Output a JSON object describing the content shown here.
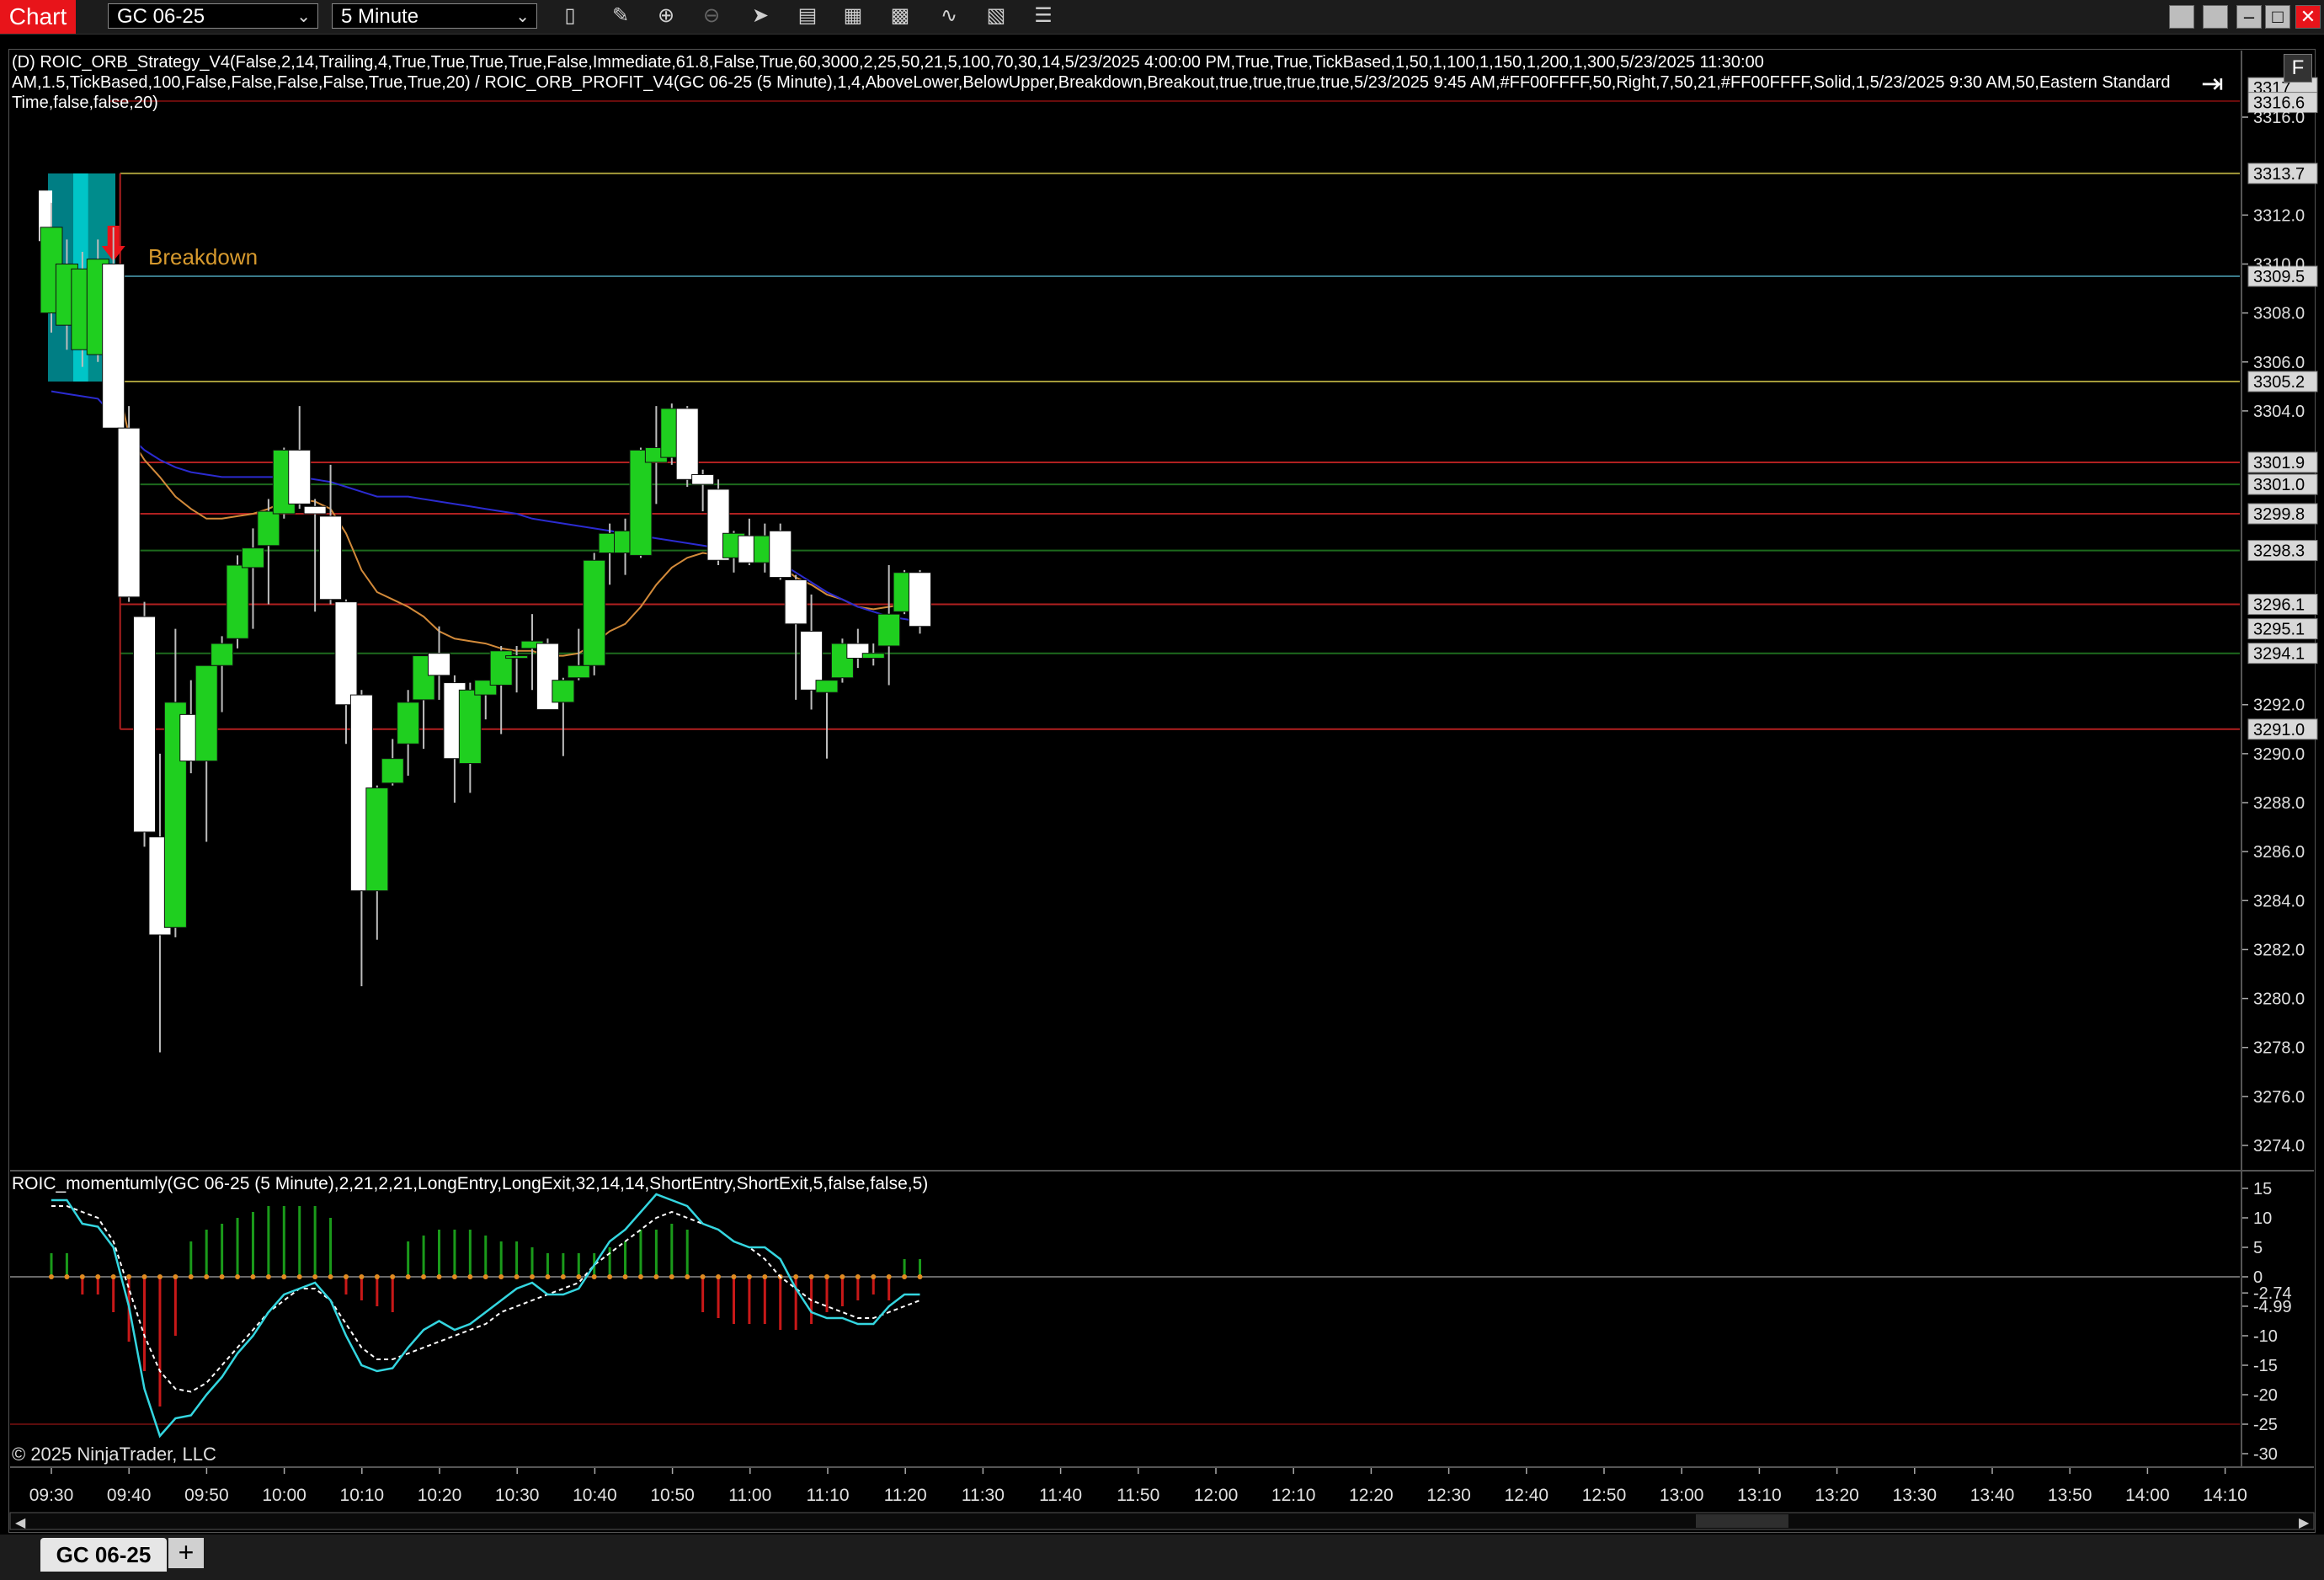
{
  "toolbar": {
    "chart_tab_label": "Chart",
    "instrument_value": "GC 06-25",
    "interval_value": "5 Minute",
    "icons": [
      "bar-type-icon",
      "drawing-tool-icon",
      "zoom-in-icon",
      "zoom-out-icon",
      "pointer-icon",
      "data-box-icon",
      "properties-icon",
      "indicators-icon",
      "strategies-icon",
      "template-icon",
      "more-icon"
    ]
  },
  "labels": {
    "strategy": "(D) ROIC_ORB_Strategy_V4(False,2,14,Trailing,4,True,True,True,True,False,Immediate,61.8,False,True,60,3000,2,25,50,21,5,100,70,30,14,5/23/2025 4:00:00 PM,True,True,TickBased,1,50,1,100,1,150,1,200,1,300,5/23/2025 11:30:00 AM,1.5,TickBased,100,False,False,False,False,True,True,20) / ROIC_ORB_PROFIT_V4(GC 06-25 (5 Minute),1,4,AboveLower,BelowUpper,Breakdown,Breakout,true,true,true,true,5/23/2025 9:45 AM,#FF00FFFF,50,Right,7,50,21,#FF00FFFF,Solid,1,5/23/2025 9:30 AM,50,Eastern Standard Time,false,false,20)",
    "indicator": "ROIC_momentumly(GC 06-25 (5 Minute),2,21,2,21,LongEntry,LongExit,32,14,14,ShortEntry,ShortExit,5,false,false,5)",
    "breakdown": "Breakdown",
    "copyright": "© 2025 NinjaTrader, LLC",
    "instrument_tab": "GC 06-25",
    "add_tab": "+",
    "panel_button": "F"
  },
  "price_axis": {
    "ticks": [
      "3316.0",
      "3312.0",
      "3310.0",
      "3308.0",
      "3306.0",
      "3304.0",
      "3292.0",
      "3290.0",
      "3288.0",
      "3286.0",
      "3284.0",
      "3282.0",
      "3280.0",
      "3278.0",
      "3276.0",
      "3274.0"
    ],
    "price_markers": [
      "3317",
      "3316.6",
      "3313.7",
      "3309.5",
      "3305.2",
      "3301.9",
      "3301.0",
      "3299.8",
      "3298.3",
      "3296.1",
      "3295.1",
      "3294.1",
      "3291.0"
    ]
  },
  "oscillator_axis": {
    "ticks": [
      "15",
      "10",
      "5",
      "0",
      "-2.74",
      "-4.99",
      "-10",
      "-15",
      "-20",
      "-25",
      "-30"
    ]
  },
  "time_axis": {
    "labels": [
      "09:30",
      "09:40",
      "09:50",
      "10:00",
      "10:10",
      "10:20",
      "10:30",
      "10:40",
      "10:50",
      "11:00",
      "11:10",
      "11:20",
      "11:30",
      "11:40",
      "11:50",
      "12:00",
      "12:10",
      "12:20",
      "12:30",
      "12:40",
      "12:50",
      "13:00",
      "13:10",
      "13:20",
      "13:30",
      "13:40",
      "13:50",
      "14:00",
      "14:10"
    ]
  },
  "colors": {
    "up_candle": "#1fcf1f",
    "down_candle": "#ffffff",
    "accent_red": "#e8141a",
    "range_box": "#00e5f0",
    "ema_orange": "#d28a3a",
    "ema_blue": "#2b2bd0",
    "osc_cyan": "#34d6e0"
  },
  "chart_data": {
    "type": "candlestick",
    "price_pane": {
      "ylim": [
        3272,
        3318
      ],
      "candles": [
        {
          "time": "09:30",
          "o": 3308,
          "h": 3312.5,
          "l": 3307.2,
          "c": 3311.5
        },
        {
          "time": "09:35",
          "o": 3307.5,
          "h": 3311.0,
          "l": 3306.5,
          "c": 3310.0
        },
        {
          "time": "09:40",
          "o": 3306.5,
          "h": 3310.5,
          "l": 3305.8,
          "c": 3309.8
        },
        {
          "time": "09:45",
          "o": 3306.3,
          "h": 3311.0,
          "l": 3306.0,
          "c": 3310.2
        },
        {
          "time": "09:50",
          "o": 3310.0,
          "h": 3311.5,
          "l": 3303.3,
          "c": 3303.3
        },
        {
          "time": "09:55",
          "o": 3303.3,
          "h": 3304.2,
          "l": 3296.2,
          "c": 3296.4
        },
        {
          "time": "10:00",
          "o": 3295.6,
          "h": 3296.2,
          "l": 3286.2,
          "c": 3286.8
        },
        {
          "time": "10:05",
          "o": 3286.6,
          "h": 3290.0,
          "l": 3277.8,
          "c": 3282.6
        },
        {
          "time": "10:10",
          "o": 3282.9,
          "h": 3295.1,
          "l": 3282.5,
          "c": 3292.1
        },
        {
          "time": "10:15",
          "o": 3291.6,
          "h": 3293.0,
          "l": 3289.2,
          "c": 3289.7
        },
        {
          "time": "10:20",
          "o": 3289.7,
          "h": 3293.6,
          "l": 3286.4,
          "c": 3293.6
        },
        {
          "time": "10:25",
          "o": 3293.6,
          "h": 3294.8,
          "l": 3291.7,
          "c": 3294.5
        },
        {
          "time": "10:30",
          "o": 3294.7,
          "h": 3298.1,
          "l": 3294.3,
          "c": 3297.7
        },
        {
          "time": "10:35",
          "o": 3297.6,
          "h": 3299.2,
          "l": 3295.1,
          "c": 3298.4
        },
        {
          "time": "10:40",
          "o": 3298.5,
          "h": 3300.4,
          "l": 3296.1,
          "c": 3299.9
        },
        {
          "time": "10:45",
          "o": 3299.8,
          "h": 3302.5,
          "l": 3299.6,
          "c": 3302.4
        },
        {
          "time": "10:50",
          "o": 3302.4,
          "h": 3304.2,
          "l": 3300.0,
          "c": 3300.2
        },
        {
          "time": "10:55",
          "o": 3300.1,
          "h": 3300.4,
          "l": 3295.8,
          "c": 3299.8
        },
        {
          "time": "11:00",
          "o": 3299.7,
          "h": 3301.8,
          "l": 3296.1,
          "c": 3296.3
        },
        {
          "time": "11:05",
          "o": 3296.2,
          "h": 3296.3,
          "l": 3290.4,
          "c": 3292.0
        },
        {
          "time": "11:10",
          "o": 3292.4,
          "h": 3292.6,
          "l": 3280.5,
          "c": 3284.4
        },
        {
          "time": "11:15",
          "o": 3284.4,
          "h": 3288.7,
          "l": 3282.4,
          "c": 3288.6
        },
        {
          "time": "11:20",
          "o": 3288.8,
          "h": 3290.6,
          "l": 3288.7,
          "c": 3289.8
        },
        {
          "time": "11:25",
          "o": 3290.4,
          "h": 3292.6,
          "l": 3289.1,
          "c": 3292.1
        },
        {
          "time": "11:30",
          "o": 3292.2,
          "h": 3294.0,
          "l": 3290.2,
          "c": 3294.0
        },
        {
          "time": "11:35",
          "o": 3294.1,
          "h": 3295.2,
          "l": 3292.2,
          "c": 3293.2
        },
        {
          "time": "11:40",
          "o": 3292.9,
          "h": 3293.2,
          "l": 3288.0,
          "c": 3289.8
        },
        {
          "time": "11:45",
          "o": 3289.6,
          "h": 3292.9,
          "l": 3288.4,
          "c": 3292.6
        },
        {
          "time": "11:50",
          "o": 3292.4,
          "h": 3293.0,
          "l": 3291.4,
          "c": 3293.0
        },
        {
          "time": "11:55",
          "o": 3292.8,
          "h": 3294.4,
          "l": 3290.8,
          "c": 3294.2
        },
        {
          "time": "12:00",
          "o": 3294.0,
          "h": 3294.4,
          "l": 3292.5,
          "c": 3294.0
        },
        {
          "time": "12:05",
          "o": 3294.3,
          "h": 3295.7,
          "l": 3292.6,
          "c": 3294.6
        },
        {
          "time": "12:10",
          "o": 3294.5,
          "h": 3294.7,
          "l": 3291.8,
          "c": 3291.8
        },
        {
          "time": "12:15",
          "o": 3292.1,
          "h": 3293.1,
          "l": 3289.9,
          "c": 3293.0
        },
        {
          "time": "12:20",
          "o": 3293.1,
          "h": 3295.1,
          "l": 3293.0,
          "c": 3293.6
        },
        {
          "time": "12:25",
          "o": 3293.6,
          "h": 3298.2,
          "l": 3293.2,
          "c": 3297.9
        },
        {
          "time": "12:30",
          "o": 3298.2,
          "h": 3299.4,
          "l": 3296.9,
          "c": 3299.0
        },
        {
          "time": "12:35",
          "o": 3298.2,
          "h": 3299.6,
          "l": 3297.3,
          "c": 3299.1
        },
        {
          "time": "12:40",
          "o": 3298.1,
          "h": 3302.5,
          "l": 3298.0,
          "c": 3302.4
        },
        {
          "time": "12:45",
          "o": 3301.9,
          "h": 3304.2,
          "l": 3300.2,
          "c": 3302.5
        },
        {
          "time": "12:50",
          "o": 3302.1,
          "h": 3304.3,
          "l": 3301.8,
          "c": 3304.1
        },
        {
          "time": "12:55",
          "o": 3304.1,
          "h": 3304.2,
          "l": 3300.9,
          "c": 3301.2
        },
        {
          "time": "13:00",
          "o": 3301.4,
          "h": 3301.6,
          "l": 3299.9,
          "c": 3301.0
        },
        {
          "time": "13:05",
          "o": 3300.8,
          "h": 3301.2,
          "l": 3297.7,
          "c": 3297.9
        },
        {
          "time": "13:10",
          "o": 3298.0,
          "h": 3299.1,
          "l": 3297.4,
          "c": 3299.0
        },
        {
          "time": "13:15",
          "o": 3298.9,
          "h": 3299.6,
          "l": 3297.7,
          "c": 3297.8
        },
        {
          "time": "13:20",
          "o": 3297.8,
          "h": 3299.4,
          "l": 3297.4,
          "c": 3298.9
        },
        {
          "time": "13:25",
          "o": 3299.1,
          "h": 3299.4,
          "l": 3297.1,
          "c": 3297.2
        },
        {
          "time": "13:30",
          "o": 3297.1,
          "h": 3297.3,
          "l": 3292.2,
          "c": 3295.3
        },
        {
          "time": "13:35",
          "o": 3295.0,
          "h": 3296.5,
          "l": 3291.8,
          "c": 3292.6
        },
        {
          "time": "13:40",
          "o": 3292.5,
          "h": 3293.0,
          "l": 3289.8,
          "c": 3293.0
        },
        {
          "time": "13:45",
          "o": 3293.1,
          "h": 3294.7,
          "l": 3292.9,
          "c": 3294.5
        },
        {
          "time": "13:50",
          "o": 3294.5,
          "h": 3295.1,
          "l": 3293.5,
          "c": 3293.9
        },
        {
          "time": "13:55",
          "o": 3293.9,
          "h": 3294.5,
          "l": 3293.6,
          "c": 3294.1
        },
        {
          "time": "14:00",
          "o": 3294.4,
          "h": 3297.7,
          "l": 3292.8,
          "c": 3295.7
        },
        {
          "time": "14:05",
          "o": 3295.8,
          "h": 3297.5,
          "l": 3295.7,
          "c": 3297.4
        },
        {
          "time": "14:10",
          "o": 3297.4,
          "h": 3297.5,
          "l": 3294.9,
          "c": 3295.2
        }
      ],
      "range_box": {
        "from": "09:30",
        "to": "09:45",
        "low": 3305.2,
        "high": 3313.7
      },
      "horizontal_levels": [
        {
          "price": 3313.7,
          "color": "#a49a3a"
        },
        {
          "price": 3309.5,
          "color": "#3a7a8a"
        },
        {
          "price": 3305.2,
          "color": "#a49a3a"
        },
        {
          "price": 3301.9,
          "color": "#b02020"
        },
        {
          "price": 3301.0,
          "color": "#1d6a1d"
        },
        {
          "price": 3299.8,
          "color": "#b02020"
        },
        {
          "price": 3298.3,
          "color": "#1d6a1d"
        },
        {
          "price": 3296.1,
          "color": "#b02020"
        },
        {
          "price": 3294.1,
          "color": "#1d6a1d"
        },
        {
          "price": 3291.0,
          "color": "#b02020"
        }
      ],
      "ema_fast": [
        3310.0,
        3309.5,
        3309.0,
        3308.5,
        3306.0,
        3303.0,
        3302.0,
        3301.3,
        3300.5,
        3300.0,
        3299.6,
        3299.6,
        3299.7,
        3299.8,
        3300.0,
        3300.3,
        3300.4,
        3300.3,
        3300.0,
        3299.0,
        3297.5,
        3296.6,
        3296.3,
        3296.0,
        3295.6,
        3295.0,
        3294.7,
        3294.6,
        3294.5,
        3294.3,
        3294.2,
        3294.2,
        3294.0,
        3294.0,
        3294.1,
        3294.5,
        3295.0,
        3295.3,
        3296.0,
        3296.9,
        3297.6,
        3298.0,
        3298.2,
        3298.1,
        3298.1,
        3298.1,
        3298.0,
        3297.7,
        3297.2,
        3296.9,
        3296.5,
        3296.3,
        3296.0,
        3295.9,
        3296.0,
        3296.1,
        3296.2
      ],
      "ema_slow": [
        3304.8,
        3304.7,
        3304.6,
        3304.5,
        3303.8,
        3303.0,
        3302.4,
        3302.0,
        3301.7,
        3301.5,
        3301.4,
        3301.3,
        3301.3,
        3301.3,
        3301.3,
        3301.3,
        3301.3,
        3301.2,
        3301.1,
        3300.9,
        3300.7,
        3300.5,
        3300.5,
        3300.5,
        3300.4,
        3300.3,
        3300.2,
        3300.1,
        3300.0,
        3299.9,
        3299.8,
        3299.6,
        3299.5,
        3299.4,
        3299.3,
        3299.2,
        3299.1,
        3299.0,
        3298.9,
        3298.8,
        3298.7,
        3298.6,
        3298.5,
        3298.4,
        3298.3,
        3298.2,
        3298.1,
        3297.8,
        3297.4,
        3297.0,
        3296.6,
        3296.3,
        3296.0,
        3295.8,
        3295.6,
        3295.5,
        3295.4
      ]
    },
    "oscillator_pane": {
      "ylim": [
        -31,
        16
      ],
      "signal_cyan": [
        13,
        13,
        9,
        8.5,
        5,
        -5,
        -19,
        -27,
        -24,
        -23.5,
        -20,
        -17,
        -13,
        -10,
        -6,
        -3,
        -2,
        -1,
        -4,
        -10,
        -15,
        -16,
        -15.5,
        -12,
        -9,
        -7.5,
        -9,
        -8,
        -6,
        -4,
        -2,
        -1,
        -3,
        -3,
        -2,
        2,
        6,
        8,
        11,
        14,
        13,
        12,
        9,
        8,
        6,
        5,
        5,
        3,
        -2,
        -6,
        -7,
        -7,
        -8,
        -8,
        -5,
        -3,
        -3
      ],
      "signal_white": [
        12,
        12,
        11,
        10,
        6,
        -2,
        -10,
        -16,
        -19,
        -19.5,
        -18,
        -15,
        -12,
        -9,
        -6,
        -4,
        -2,
        -2,
        -4,
        -8,
        -12,
        -14,
        -14,
        -13,
        -12,
        -11,
        -10,
        -9,
        -8,
        -6,
        -5,
        -4,
        -3,
        -2,
        -1,
        2,
        4,
        6,
        8,
        10,
        11,
        10,
        9,
        8,
        6,
        5,
        3,
        0,
        -2,
        -4,
        -5,
        -6,
        -7,
        -7,
        -6,
        -5,
        -4
      ],
      "histogram": [
        4,
        4,
        -3,
        -3,
        -6,
        -11,
        -16,
        -22,
        -10,
        6,
        8,
        9,
        10,
        11,
        12,
        12,
        12,
        12,
        10,
        -3,
        -4,
        -5,
        -6,
        6,
        7,
        8,
        8,
        8,
        7,
        6,
        6,
        5,
        4,
        4,
        4,
        4,
        5,
        6,
        8,
        8,
        9,
        8,
        -6,
        -7,
        -8,
        -8,
        -8,
        -9,
        -9,
        -8,
        -6,
        -5,
        -4,
        -3,
        -4,
        3,
        3
      ],
      "zero_line": 0,
      "lower_band": -25
    }
  }
}
